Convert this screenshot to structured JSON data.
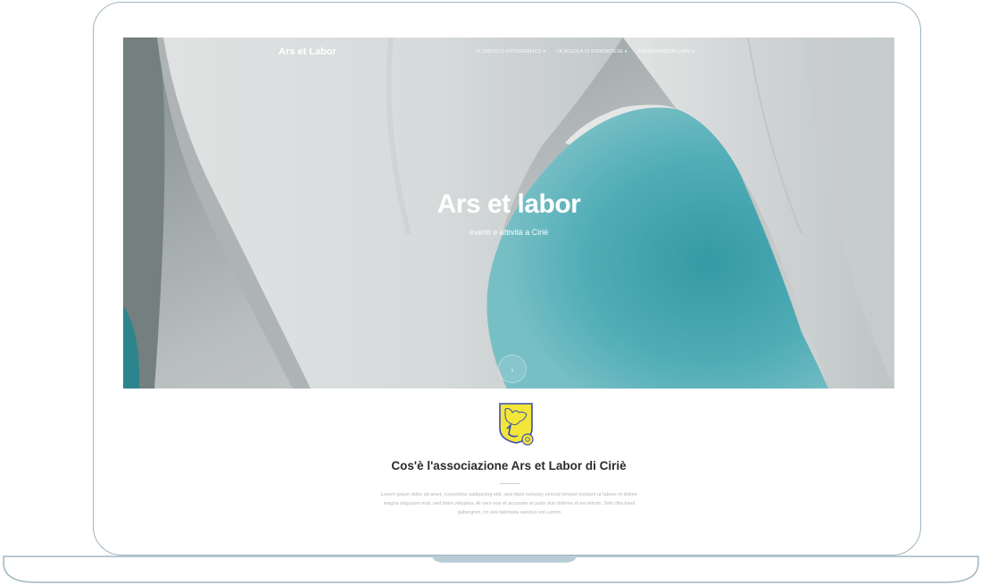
{
  "header": {
    "brand": "Ars et Labor",
    "nav": [
      {
        "label": "IL CIRCOLO FOTOGRAFICO ▾"
      },
      {
        "label": "LA SCUOLA DI PIEMONTESE ▾"
      },
      {
        "label": "PRESENTAZIONI LIBRI ▾"
      }
    ]
  },
  "hero": {
    "title": "Ars et labor",
    "subtitle": "eventi e attività a Ciriè",
    "scroll_icon": "arrow-down-icon"
  },
  "about": {
    "logo_icon": "association-crest-icon",
    "title": "Cos'è l'associazione Ars et Labor di Ciriè",
    "body": "Lorem ipsum dolor sit amet, consetetur sadipscing elitr, sed diam nonumy eirmod tempor invidunt ut labore et dolore magna aliquyam erat, sed diam voluptua. At vero eos et accusam et justo duo dolores et ea rebum. Stet clita kasd gubergren, no sea takimata sanctus est Lorem"
  },
  "colors": {
    "frame": "#9fb6c2",
    "ice_light": "#e6eaeb",
    "ice_shadow": "#8d9698",
    "water": "#4fb3bd",
    "water_deep": "#2b8e99",
    "logo_yellow": "#f3e63a",
    "logo_blue": "#3b4fb0"
  }
}
